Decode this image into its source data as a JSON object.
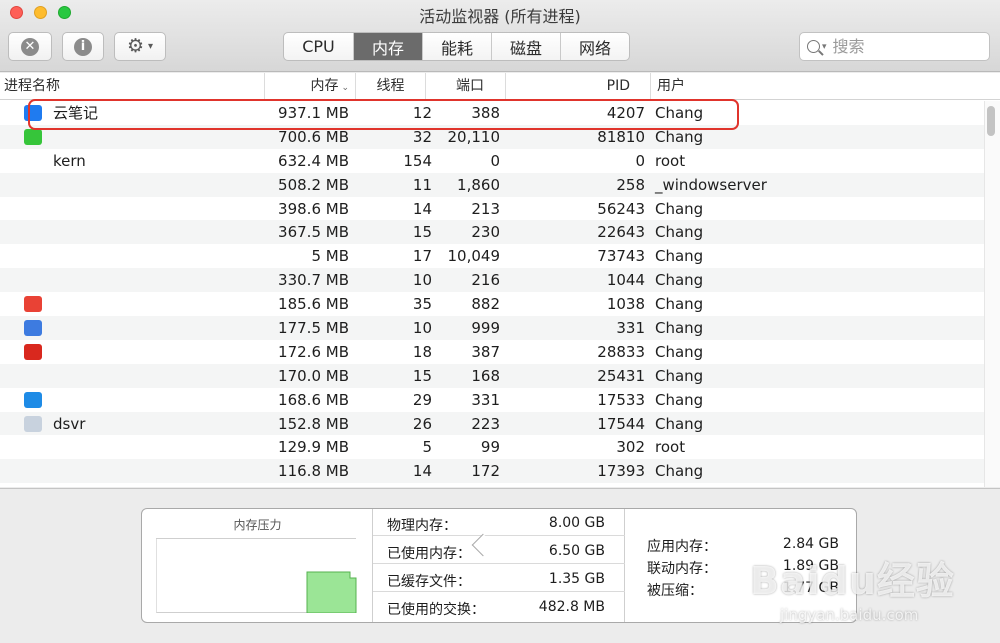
{
  "window": {
    "title": "活动监视器 (所有进程)"
  },
  "toolbar": {
    "tabs": [
      {
        "label": "CPU",
        "active": false
      },
      {
        "label": "内存",
        "active": true
      },
      {
        "label": "能耗",
        "active": false
      },
      {
        "label": "磁盘",
        "active": false
      },
      {
        "label": "网络",
        "active": false
      }
    ],
    "search_placeholder": "搜索"
  },
  "table": {
    "headers": {
      "name": "进程名称",
      "memory": "内存",
      "threads": "线程",
      "ports": "端口",
      "pid": "PID",
      "user": "用户"
    },
    "rows": [
      {
        "name": "云笔记",
        "memory": "937.1 MB",
        "threads": "12",
        "ports": "388",
        "pid": "4207",
        "user": "Chang",
        "icon_color": "#1f7bf0"
      },
      {
        "name": "",
        "memory": "700.6 MB",
        "threads": "32",
        "ports": "20,110",
        "pid": "81810",
        "user": "Chang",
        "icon_color": "#36c53a"
      },
      {
        "name": "kern",
        "memory": "632.4 MB",
        "threads": "154",
        "ports": "0",
        "pid": "0",
        "user": "root",
        "icon_color": ""
      },
      {
        "name": "",
        "memory": "508.2 MB",
        "threads": "11",
        "ports": "1,860",
        "pid": "258",
        "user": "_windowserver",
        "icon_color": ""
      },
      {
        "name": "",
        "memory": "398.6 MB",
        "threads": "14",
        "ports": "213",
        "pid": "56243",
        "user": "Chang",
        "icon_color": ""
      },
      {
        "name": "",
        "memory": "367.5 MB",
        "threads": "15",
        "ports": "230",
        "pid": "22643",
        "user": "Chang",
        "icon_color": ""
      },
      {
        "name": "",
        "memory": "5 MB",
        "threads": "17",
        "ports": "10,049",
        "pid": "73743",
        "user": "Chang",
        "icon_color": ""
      },
      {
        "name": "",
        "memory": "330.7 MB",
        "threads": "10",
        "ports": "216",
        "pid": "1044",
        "user": "Chang",
        "icon_color": ""
      },
      {
        "name": "",
        "memory": "185.6 MB",
        "threads": "35",
        "ports": "882",
        "pid": "1038",
        "user": "Chang",
        "icon_color": "#e94235"
      },
      {
        "name": "",
        "memory": "177.5 MB",
        "threads": "10",
        "ports": "999",
        "pid": "331",
        "user": "Chang",
        "icon_color": "#3d7be0"
      },
      {
        "name": "",
        "memory": "172.6 MB",
        "threads": "18",
        "ports": "387",
        "pid": "28833",
        "user": "Chang",
        "icon_color": "#d9281e"
      },
      {
        "name": "",
        "memory": "170.0 MB",
        "threads": "15",
        "ports": "168",
        "pid": "25431",
        "user": "Chang",
        "icon_color": ""
      },
      {
        "name": "",
        "memory": "168.6 MB",
        "threads": "29",
        "ports": "331",
        "pid": "17533",
        "user": "Chang",
        "icon_color": "#1e8be6"
      },
      {
        "name": "dsvr",
        "memory": "152.8 MB",
        "threads": "26",
        "ports": "223",
        "pid": "17544",
        "user": "Chang",
        "icon_color": "#c8d2de"
      },
      {
        "name": "",
        "memory": "129.9 MB",
        "threads": "5",
        "ports": "99",
        "pid": "302",
        "user": "root",
        "icon_color": ""
      },
      {
        "name": "",
        "memory": "116.8 MB",
        "threads": "14",
        "ports": "172",
        "pid": "17393",
        "user": "Chang",
        "icon_color": ""
      }
    ]
  },
  "memory_pressure": {
    "title": "内存压力"
  },
  "stats": [
    {
      "label": "物理内存：",
      "value": "8.00 GB"
    },
    {
      "label": "已使用内存：",
      "value": "6.50 GB"
    },
    {
      "label": "已缓存文件：",
      "value": "1.35 GB"
    },
    {
      "label": "已使用的交换：",
      "value": "482.8 MB"
    }
  ],
  "right_stats": [
    {
      "label": "应用内存：",
      "value": "2.84 GB"
    },
    {
      "label": "联动内存：",
      "value": "1.89 GB"
    },
    {
      "label": "被压缩：",
      "value": "1.77 GB"
    }
  ],
  "watermark": {
    "text": "Baidu经验",
    "url": "jingyan.baidu.com"
  }
}
